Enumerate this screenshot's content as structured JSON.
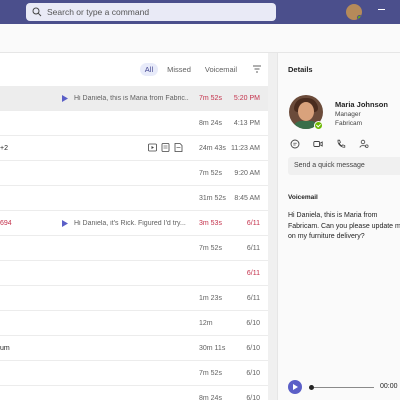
{
  "titlebar": {
    "search_placeholder": "Search or type a command"
  },
  "filters": {
    "all": "All",
    "missed": "Missed",
    "voicemail": "Voicemail"
  },
  "calls": [
    {
      "name": "",
      "name_red": false,
      "preview": "Hi Daniela, this is Maria from Fabric...",
      "has_play": true,
      "duration": "7m 52s",
      "duration_red": true,
      "time": "5:20 PM",
      "time_red": true,
      "selected": true
    },
    {
      "name": "",
      "name_red": false,
      "preview": "",
      "has_play": false,
      "duration": "8m 24s",
      "duration_red": false,
      "time": "4:13 PM",
      "time_red": false
    },
    {
      "name": "+2",
      "name_red": false,
      "preview": "",
      "has_play": false,
      "duration": "24m 43s",
      "duration_red": false,
      "time": "11:23 AM",
      "time_red": false,
      "has_actions": true
    },
    {
      "name": "",
      "name_red": false,
      "preview": "",
      "has_play": false,
      "duration": "7m 52s",
      "duration_red": false,
      "time": "9:20 AM",
      "time_red": false
    },
    {
      "name": "",
      "name_red": false,
      "preview": "",
      "has_play": false,
      "duration": "31m 52s",
      "duration_red": false,
      "time": "8:45 AM",
      "time_red": false
    },
    {
      "name": "694",
      "name_red": true,
      "preview": "Hi Daniela, it's Rick. Figured I'd try...",
      "has_play": true,
      "duration": "3m 53s",
      "duration_red": true,
      "time": "6/11",
      "time_red": true
    },
    {
      "name": "",
      "name_red": false,
      "preview": "",
      "has_play": false,
      "duration": "7m 52s",
      "duration_red": false,
      "time": "6/11",
      "time_red": false
    },
    {
      "name": "",
      "name_red": false,
      "preview": "",
      "has_play": false,
      "duration": "",
      "duration_red": false,
      "time": "6/11",
      "time_red": true
    },
    {
      "name": "",
      "name_red": false,
      "preview": "",
      "has_play": false,
      "duration": "1m 23s",
      "duration_red": false,
      "time": "6/11",
      "time_red": false
    },
    {
      "name": "",
      "name_red": false,
      "preview": "",
      "has_play": false,
      "duration": "12m",
      "duration_red": false,
      "time": "6/10",
      "time_red": false
    },
    {
      "name": "um",
      "name_red": false,
      "preview": "",
      "has_play": false,
      "duration": "30m 11s",
      "duration_red": false,
      "time": "6/10",
      "time_red": false
    },
    {
      "name": "",
      "name_red": false,
      "preview": "",
      "has_play": false,
      "duration": "7m 52s",
      "duration_red": false,
      "time": "6/10",
      "time_red": false
    },
    {
      "name": "",
      "name_red": false,
      "preview": "",
      "has_play": false,
      "duration": "8m 24s",
      "duration_red": false,
      "time": "6/10",
      "time_red": false
    }
  ],
  "details": {
    "heading": "Details",
    "contact_name": "Maria Johnson",
    "contact_title": "Manager",
    "contact_company": "Fabricam",
    "quick_message_placeholder": "Send a quick message",
    "voicemail_label": "Voicemail",
    "voicemail_text": "Hi Daniela, this is Maria from Fabricam. Can you please update me on my furniture delivery?",
    "voicemail_time": "00:00"
  },
  "colors": {
    "titlebar": "#4b4f8c",
    "accent": "#5b5fc7",
    "missed": "#c4314b",
    "presence": "#6bb700"
  }
}
